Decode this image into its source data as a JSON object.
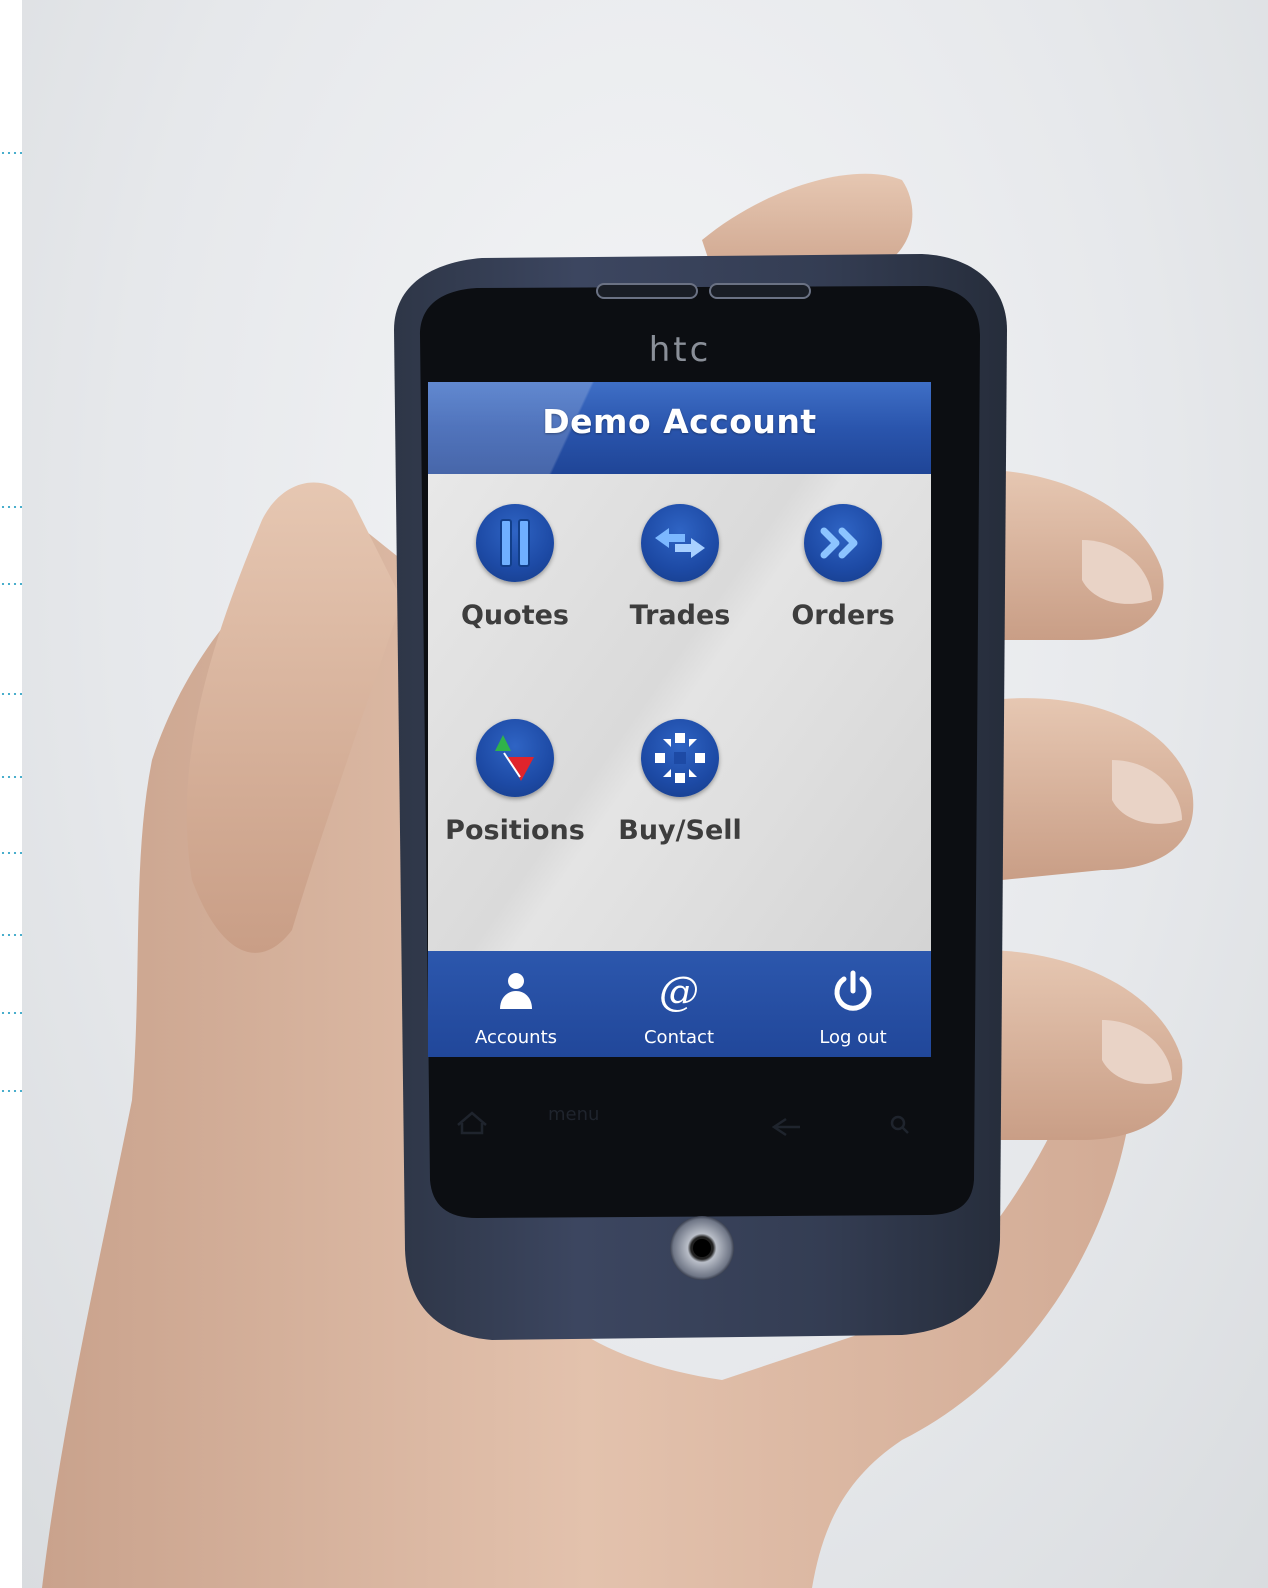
{
  "device": {
    "brand": "htc"
  },
  "header": {
    "title": "Demo Account"
  },
  "menu": {
    "tiles": [
      {
        "label": "Quotes",
        "icon": "candlestick-icon"
      },
      {
        "label": "Trades",
        "icon": "exchange-arrows-icon"
      },
      {
        "label": "Orders",
        "icon": "double-chevron-right-icon"
      },
      {
        "label": "Positions",
        "icon": "up-down-triangles-icon"
      },
      {
        "label": "Buy/Sell",
        "icon": "bank-logo-icon"
      }
    ]
  },
  "bottom_nav": {
    "items": [
      {
        "label": "Accounts",
        "icon": "person-icon"
      },
      {
        "label": "Contact",
        "icon": "at-sign-icon"
      },
      {
        "label": "Log out",
        "icon": "power-icon"
      }
    ]
  },
  "hardware_keys": {
    "menu_label": "menu"
  },
  "colors": {
    "primary_blue": "#2a55ad",
    "icon_blue": "#1d4aa5",
    "screen_bg": "#dcdcdc",
    "label_text": "#3d3d3d",
    "up_green": "#2fb34a",
    "down_red": "#e0242b"
  }
}
